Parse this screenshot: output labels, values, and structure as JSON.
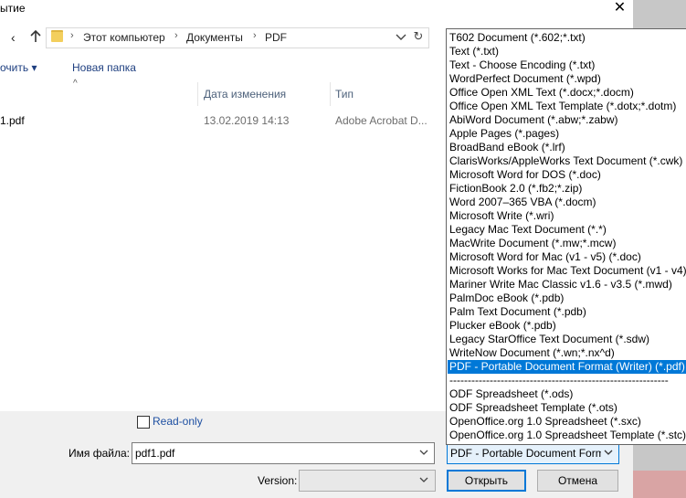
{
  "window": {
    "title": "ытие",
    "close_glyph": "✕"
  },
  "nav": {
    "back_glyph": "‹",
    "breadcrumbs": [
      "Этот компьютер",
      "Документы",
      "PDF"
    ],
    "sep_glyph": "›",
    "refresh_glyph": "↻"
  },
  "toolbar": {
    "organize": "очить ▾",
    "new_folder": "Новая папка",
    "sort_glyph": "^"
  },
  "file_list": {
    "headers": [
      "Дата изменения",
      "Тип"
    ],
    "rows": [
      {
        "name": "1.pdf",
        "modified": "13.02.2019 14:13",
        "type": "Adobe Acrobat D..."
      }
    ]
  },
  "options": {
    "read_only_label": "Read-only",
    "read_only_checked": false,
    "filename_label": "Имя файла:",
    "filename_value": "pdf1.pdf",
    "version_label": "Version:",
    "version_value": ""
  },
  "file_type": {
    "selected_display": "PDF - Portable Document Form",
    "items": [
      "T602 Document (*.602;*.txt)",
      "Text (*.txt)",
      "Text - Choose Encoding (*.txt)",
      "WordPerfect Document (*.wpd)",
      "Office Open XML Text (*.docx;*.docm)",
      "Office Open XML Text Template (*.dotx;*.dotm)",
      "AbiWord Document (*.abw;*.zabw)",
      "Apple Pages (*.pages)",
      "BroadBand eBook (*.lrf)",
      "ClarisWorks/AppleWorks Text Document (*.cwk)",
      "Microsoft Word for DOS (*.doc)",
      "FictionBook 2.0 (*.fb2;*.zip)",
      "Word 2007–365 VBA (*.docm)",
      "Microsoft Write (*.wri)",
      "Legacy Mac Text Document (*.*)",
      "MacWrite Document (*.mw;*.mcw)",
      "Microsoft Word for Mac (v1 - v5) (*.doc)",
      "Microsoft Works for Mac Text Document (v1 - v4)",
      "Mariner Write Mac Classic v1.6 - v3.5 (*.mwd)",
      "PalmDoc eBook (*.pdb)",
      "Palm Text Document (*.pdb)",
      "Plucker eBook (*.pdb)",
      "Legacy StarOffice Text Document (*.sdw)",
      "WriteNow Document (*.wn;*.nx^d)",
      "PDF - Portable Document Format (Writer) (*.pdf)",
      "------------------------------------------------------------",
      "ODF Spreadsheet (*.ods)",
      "ODF Spreadsheet Template (*.ots)",
      "OpenOffice.org 1.0 Spreadsheet (*.sxc)",
      "OpenOffice.org 1.0 Spreadsheet Template (*.stc)"
    ],
    "selected_index": 24
  },
  "buttons": {
    "open": "Открыть",
    "cancel": "Отмена"
  },
  "colors": {
    "accent": "#0078d7",
    "link": "#1e3f80",
    "header": "#4c607a"
  }
}
